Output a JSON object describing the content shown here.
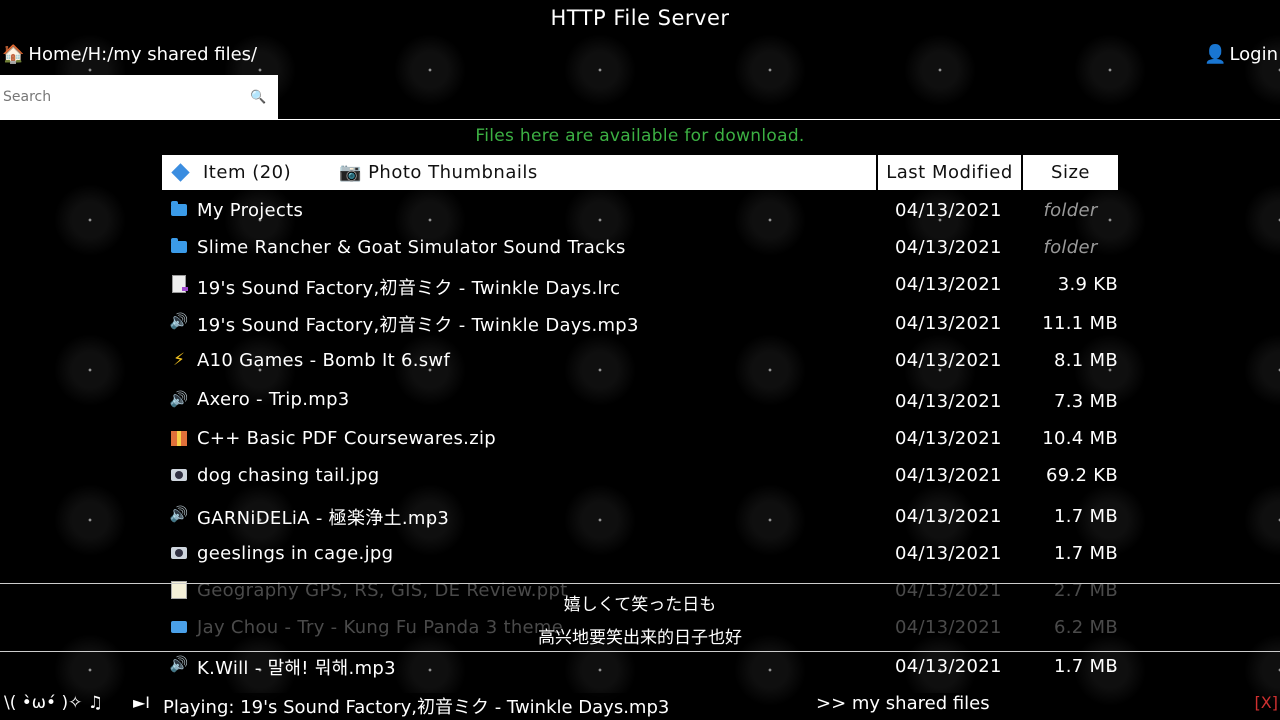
{
  "header": {
    "title": "HTTP File Server"
  },
  "breadcrumb": {
    "icon": "home-icon",
    "path": "Home/H:/my shared files/"
  },
  "login": {
    "icon": "user-icon",
    "label": "Login"
  },
  "search": {
    "placeholder": "Search",
    "icon": "search-icon"
  },
  "notice": "Files here are available for download.",
  "table": {
    "item_header": "Item (20)",
    "thumbnails_label": "Photo Thumbnails",
    "modified_header": "Last Modified",
    "size_header": "Size",
    "rows": [
      {
        "icon": "folder-icon",
        "name": "My Projects",
        "date": "04/13/2021",
        "size": "folder"
      },
      {
        "icon": "folder-icon",
        "name": "Slime Rancher & Goat Simulator Sound Tracks",
        "date": "04/13/2021",
        "size": "folder"
      },
      {
        "icon": "lyrics-file-icon",
        "name": "19's Sound Factory,初音ミク - Twinkle Days.lrc",
        "date": "04/13/2021",
        "size": "3.9 KB"
      },
      {
        "icon": "audio-icon",
        "name": "19's Sound Factory,初音ミク - Twinkle Days.mp3",
        "date": "04/13/2021",
        "size": "11.1 MB"
      },
      {
        "icon": "flash-icon",
        "name": "A10 Games - Bomb It 6.swf",
        "date": "04/13/2021",
        "size": "8.1 MB"
      },
      {
        "icon": "audio-icon",
        "name": "Axero - Trip.mp3",
        "date": "04/13/2021",
        "size": "7.3 MB"
      },
      {
        "icon": "archive-icon",
        "name": "C++ Basic PDF Coursewares.zip",
        "date": "04/13/2021",
        "size": "10.4 MB"
      },
      {
        "icon": "camera-icon",
        "name": "dog chasing tail.jpg",
        "date": "04/13/2021",
        "size": "69.2 KB"
      },
      {
        "icon": "audio-icon",
        "name": "GARNiDELiA - 極楽浄土.mp3",
        "date": "04/13/2021",
        "size": "1.7 MB"
      },
      {
        "icon": "camera-icon",
        "name": "geeslings in cage.jpg",
        "date": "04/13/2021",
        "size": "1.7 MB"
      },
      {
        "icon": "memo-icon",
        "name": "Geography GPS, RS, GIS, DE Review.ppt",
        "date": "04/13/2021",
        "size": "2.7 MB"
      },
      {
        "icon": "video-icon",
        "name": "Jay Chou - Try - Kung Fu Panda 3 theme",
        "date": "04/13/2021",
        "size": "6.2 MB"
      },
      {
        "icon": "audio-icon",
        "name": "K.Will - 말해! 뭐해.mp3",
        "date": "04/13/2021",
        "size": "1.7 MB"
      }
    ]
  },
  "lyrics": {
    "line1": "嬉しくて笑った日も",
    "line2": "高兴地要笑出来的日子也好"
  },
  "player": {
    "kaomoji": "\\( •̀ω•́ )✧ ♫",
    "next_icon": "►I",
    "now_playing": "Playing: 19's Sound Factory,初音ミク - Twinkle Days.mp3",
    "folder_link": ">> my shared files",
    "close_label": "[X]"
  }
}
